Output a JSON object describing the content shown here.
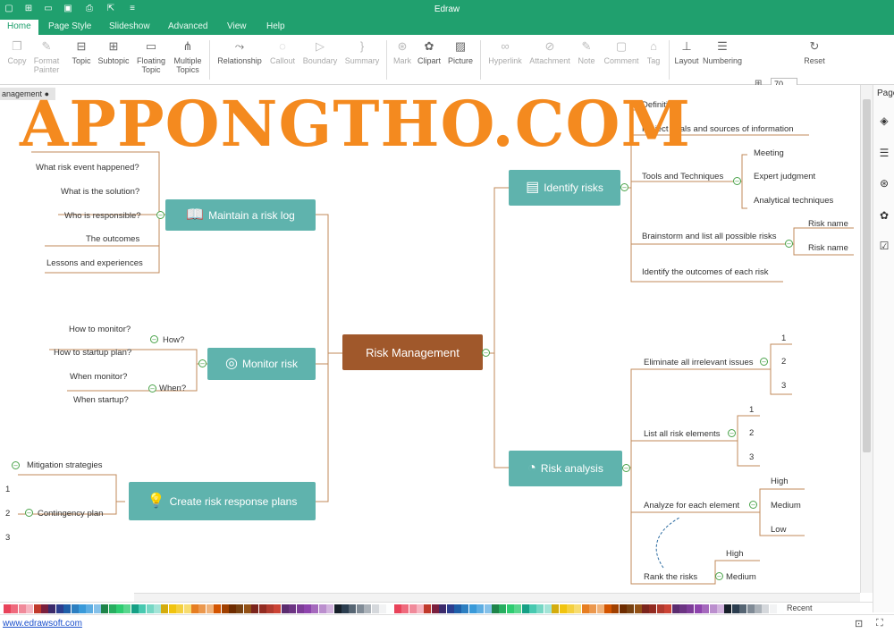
{
  "app": {
    "title": "Edraw",
    "accent_color": "#20a06e"
  },
  "quick_access": [
    "new-file-icon",
    "add-icon",
    "open-folder-icon",
    "save-icon",
    "print-icon",
    "export-icon",
    "customize-icon"
  ],
  "menu": {
    "items": [
      "Home",
      "Page Style",
      "Slideshow",
      "Advanced",
      "View",
      "Help"
    ],
    "active": "Home"
  },
  "ribbon": {
    "copy": "Copy",
    "format_painter": "Format Painter",
    "topic": "Topic",
    "subtopic": "Subtopic",
    "floating_topic": "Floating Topic",
    "multiple_topics": "Multiple Topics",
    "relationship": "Relationship",
    "callout": "Callout",
    "boundary": "Boundary",
    "summary": "Summary",
    "mark": "Mark",
    "clipart": "Clipart",
    "picture": "Picture",
    "hyperlink": "Hyperlink",
    "attachment": "Attachment",
    "note": "Note",
    "comment": "Comment",
    "tag": "Tag",
    "layout": "Layout",
    "numbering": "Numbering",
    "spacing_h": "70",
    "spacing_v": "70",
    "reset": "Reset"
  },
  "document_tab": "anagement",
  "watermark": "APPONGTHO.COM",
  "mindmap": {
    "central": "Risk Management",
    "topics": {
      "identify": "Identify risks",
      "analysis": "Risk analysis",
      "maintain": "Maintain a risk log",
      "monitor": "Monitor risk",
      "response": "Create risk response plans"
    },
    "identify_items": {
      "definition": "Definition",
      "project": "Project goals and sources of information",
      "tools": "Tools and Techniques",
      "meeting": "Meeting",
      "expert": "Expert judgment",
      "analytical": "Analytical techniques",
      "brainstorm": "Brainstorm and list all possible risks",
      "risk_name_1": "Risk name",
      "risk_name_2": "Risk name",
      "outcomes": "Identify the outcomes of each risk"
    },
    "analysis_items": {
      "eliminate": "Eliminate all irrelevant issues",
      "list_all": "List all risk elements",
      "analyze": "Analyze for each element",
      "rank": "Rank the risks",
      "high": "High",
      "medium": "Medium",
      "low": "Low",
      "rank_high": "High",
      "rank_medium": "Medium",
      "n1": "1",
      "n2": "2",
      "n3": "3"
    },
    "maintain_items": {
      "what": "What risk event happened?",
      "solution": "What is the solution?",
      "who": "Who is responsible?",
      "outcomes": "The outcomes",
      "lessons": "Lessons and experiences"
    },
    "monitor_items": {
      "how": "How?",
      "when": "When?",
      "how_monitor": "How to monitor?",
      "how_startup": "How to startup plan?",
      "when_monitor": "When monitor?",
      "when_startup": "When startup?"
    },
    "response_items": {
      "mitigation": "Mitigation strategies",
      "contingency": "Contingency plan",
      "n1": "1",
      "n2": "2",
      "n3": "3"
    }
  },
  "right_panel": {
    "label": "Page"
  },
  "palette": {
    "recent_label": "Recent"
  },
  "status": {
    "link": "www.edrawsoft.com"
  }
}
